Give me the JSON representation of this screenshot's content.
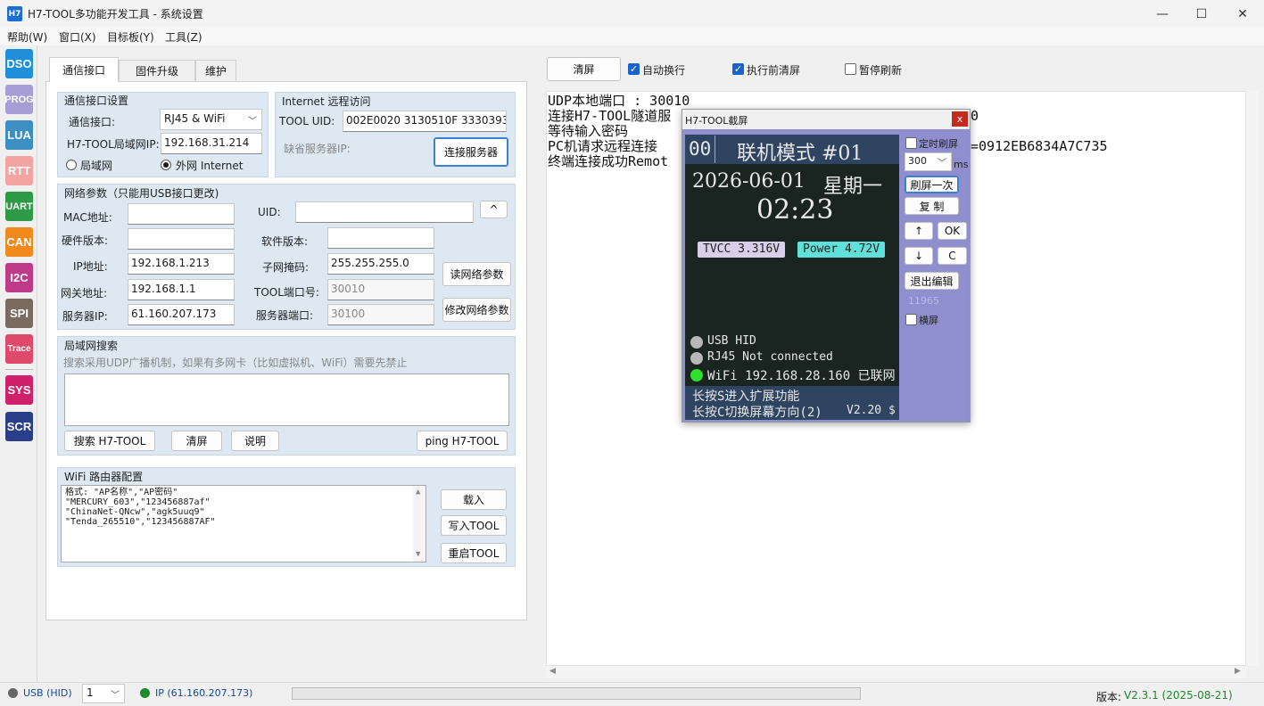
{
  "window": {
    "icon_text": "H7",
    "title": "H7-TOOL多功能开发工具 - 系统设置",
    "minimize": "—",
    "maximize": "☐",
    "close": "✕"
  },
  "menu": [
    "帮助(W)",
    "窗口(X)",
    "目标板(Y)",
    "工具(Z)"
  ],
  "sidebar": [
    {
      "label": "DSO",
      "color": "#1e8fd8"
    },
    {
      "label": "PROG",
      "color": "#a79ed6"
    },
    {
      "label": "LUA",
      "color": "#3b8fc2"
    },
    {
      "label": "RTT",
      "color": "#f4a3a3"
    },
    {
      "label": "UART",
      "color": "#2e9a48"
    },
    {
      "label": "CAN",
      "color": "#f08a1e"
    },
    {
      "label": "I2C",
      "color": "#c03a8a"
    },
    {
      "label": "SPI",
      "color": "#7a6a60"
    },
    {
      "label": "Trace",
      "color": "#e04a6a"
    },
    {
      "label": "SYS",
      "color": "#d0206a"
    },
    {
      "label": "SCR",
      "color": "#2a3e8a"
    }
  ],
  "tabs": [
    "通信接口",
    "固件升级",
    "维护"
  ],
  "comm": {
    "group_title": "通信接口设置",
    "iface_label": "通信接口:",
    "iface_value": "RJ45 & WiFi",
    "lan_ip_label": "H7-TOOL局域网IP:",
    "lan_ip_value": "192.168.31.214",
    "radio_lan": "局域网",
    "radio_wan": "外网 Internet"
  },
  "remote": {
    "group_title": "Internet 远程访问",
    "uid_label": "TOOL UID:",
    "uid_value": "002E0020 3130510F 33303938",
    "server_label": "缺省服务器IP:",
    "connect_btn": "连接服务器"
  },
  "net": {
    "group_title": "网络参数（只能用USB接口更改)",
    "mac_label": "MAC地址:",
    "uid_label": "UID:",
    "up_btn": "^",
    "hw_label": "硬件版本:",
    "sw_label": "软件版本:",
    "ip_label": "IP地址:",
    "ip_value": "192.168.1.213",
    "mask_label": "子网掩码:",
    "mask_value": "255.255.255.0",
    "gw_label": "网关地址:",
    "gw_value": "192.168.1.1",
    "port_label": "TOOL端口号:",
    "port_value": "30010",
    "srv_label": "服务器IP:",
    "srv_value": "61.160.207.173",
    "srv_port_label": "服务器端口:",
    "srv_port_value": "30100",
    "read_btn": "读网络参数",
    "modify_btn": "修改网络参数"
  },
  "search": {
    "group_title": "局域网搜索",
    "hint": "搜索采用UDP广播机制，如果有多网卡（比如虚拟机、WiFi）需要先禁止",
    "search_btn": "搜索 H7-TOOL",
    "clear_btn": "清屏",
    "help_btn": "说明",
    "ping_btn": "ping H7-TOOL"
  },
  "wifi": {
    "group_title": "WiFi 路由器配置",
    "lines": [
      "格式: \"AP名称\",\"AP密码\"",
      "\"MERCURY_603\",\"123456887af\"",
      "\"ChinaNet-QNcw\",\"agk5uuq9\"",
      "\"Tenda_265510\",\"123456887AF\""
    ],
    "load_btn": "载入",
    "write_btn": "写入TOOL",
    "restart_btn": "重启TOOL"
  },
  "toolbar": {
    "clear_btn": "清屏",
    "auto_wrap": "自动换行",
    "clear_before": "执行前清屏",
    "pause_refresh": "暂停刷新"
  },
  "log": [
    "UDP本地端口 : 30010",
    "连接H7-TOOL隧道服",
    "等待输入密码",
    "PC机请求远程连接",
    "终端连接成功Remot"
  ],
  "log_tail": {
    "line2_tail": "0",
    "line4_tail": "=0912EB6834A7C735"
  },
  "dialog": {
    "title": "H7-TOOL截屏",
    "close": "x",
    "lcd": {
      "page_no": "00",
      "mode": "联机模式 #01",
      "date": "2026-06-01",
      "weekday": "星期一",
      "time": "02:23",
      "tvcc": "TVCC 3.316V",
      "power": "Power 4.72V",
      "usb": "USB HID",
      "rj45": "RJ45 Not connected",
      "wifi": "WiFi 192.168.28.160 已联网",
      "hint1": "长按S进入扩展功能",
      "hint2": "长按C切换屏幕方向(2)",
      "version": "V2.20 $"
    },
    "timer_refresh": "定时刷屏",
    "interval": "300",
    "unit": "ms",
    "refresh_once": "刷屏一次",
    "copy": "复 制",
    "up": "↑",
    "ok": "OK",
    "down": "↓",
    "c": "C",
    "exit_edit": "退出编辑",
    "counter": "11965",
    "landscape": "横屏"
  },
  "status": {
    "usb": "USB (HID)",
    "channel": "1",
    "ip": "IP (61.160.207.173)",
    "version_label": "版本:",
    "version_value": "V2.3.1 (2025-08-21)",
    "colors": {
      "usb_dot": "#666666",
      "ip_dot": "#1a8a2a",
      "version": "#1a8a2a"
    }
  }
}
